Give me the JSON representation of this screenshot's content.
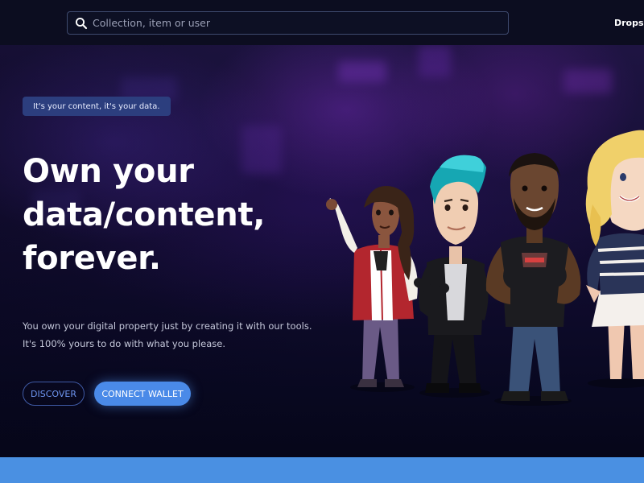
{
  "header": {
    "search": {
      "placeholder": "Collection, item or user",
      "value": "",
      "icon": "search-icon"
    },
    "nav": {
      "drops_label": "Drops"
    }
  },
  "hero": {
    "tag": "It's your content, it's your data.",
    "headline_lines": [
      "Own your",
      "data/content,",
      "forever."
    ],
    "subtext_lines": [
      "You own your digital property just by creating it with our tools.",
      "It's 100% yours to do with what you please."
    ],
    "buttons": {
      "discover_label": "DISCOVER",
      "connect_label": "CONNECT WALLET"
    },
    "illustration": "group-of-avatar-characters"
  },
  "colors": {
    "background": "#0a0b1e",
    "accent": "#4a8ae8",
    "tag_bg": "#2c3e7e",
    "bottom_bar": "#4a90e2"
  }
}
